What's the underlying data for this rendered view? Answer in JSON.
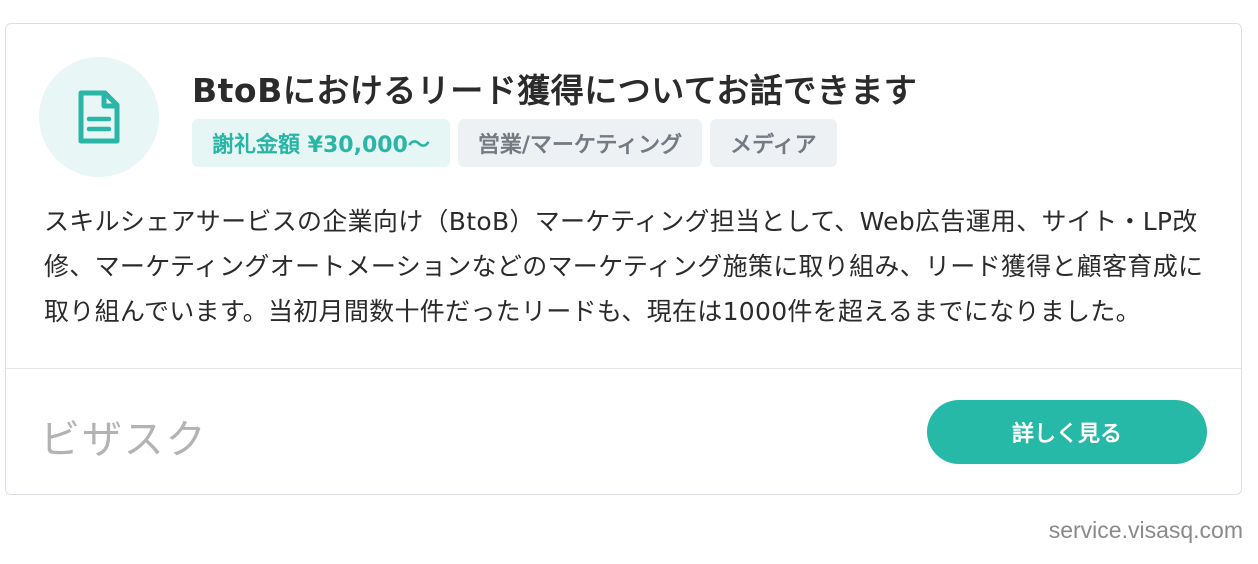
{
  "card": {
    "icon": "document-icon",
    "title": "BtoBにおけるリード獲得についてお話できます",
    "tags": {
      "reward": "謝礼金額 ¥30,000〜",
      "category": "営業/マーケティング",
      "industry": "メディア"
    },
    "description": "スキルシェアサービスの企業向け（BtoB）マーケティング担当として、Web広告運用、サイト・LP改修、マーケティングオートメーションなどのマーケティング施策に取り組み、リード獲得と顧客育成に取り組んでいます。当初月間数十件だったリードも、現在は1000件を超えるまでになりました。",
    "brand": "ビザスク",
    "button_label": "詳しく見る"
  },
  "footer": {
    "source": "service.visasq.com"
  },
  "colors": {
    "accent": "#27b9a7",
    "reward_bg": "#e6f6f4",
    "tag_bg": "#eef1f4"
  }
}
